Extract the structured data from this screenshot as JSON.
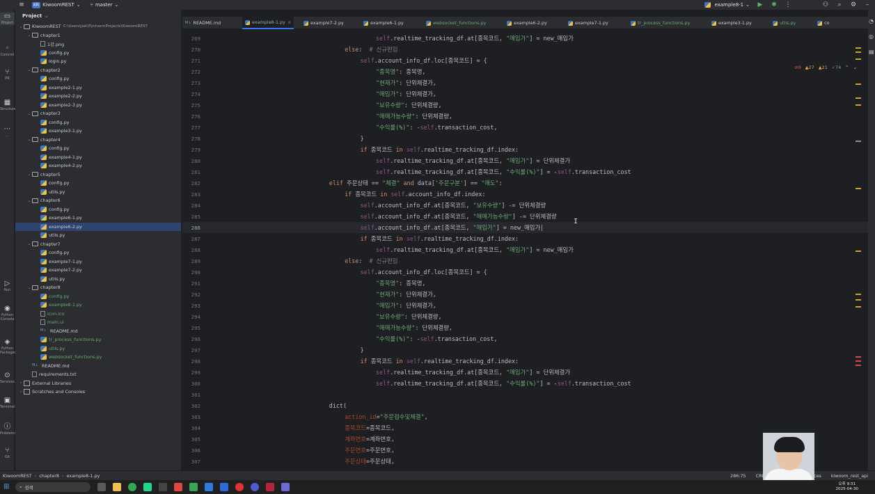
{
  "titlebar": {
    "project_badge": "KR",
    "project_name": "KiwoomREST",
    "branch": "master",
    "run_config": "example8-1"
  },
  "toolstrip": [
    {
      "label": "Project",
      "glyph": "▭"
    },
    {
      "label": "Commit",
      "glyph": "◦"
    },
    {
      "label": "PR",
      "glyph": "⑂"
    },
    {
      "label": "Structure",
      "glyph": "▦"
    },
    {
      "label": "...",
      "glyph": "⋯"
    },
    {
      "label": "Run",
      "glyph": "▷"
    },
    {
      "label": "Python Console",
      "glyph": "◉"
    },
    {
      "label": "Python Packages",
      "glyph": "◈"
    },
    {
      "label": "Services",
      "glyph": "⊙"
    },
    {
      "label": "Terminal",
      "glyph": "▣"
    },
    {
      "label": "Problems",
      "glyph": "ⓘ"
    },
    {
      "label": "Git",
      "glyph": "⑂"
    }
  ],
  "project": {
    "header": "Project",
    "tree": [
      {
        "indent": 0,
        "arrow": "v",
        "type": "folder",
        "label": "KiwoomREST",
        "note": "C:\\Users\\jwk\\PycharmProjects\\KiwoomREST"
      },
      {
        "indent": 1,
        "arrow": "v",
        "type": "folder",
        "label": "chapter1"
      },
      {
        "indent": 2,
        "arrow": "",
        "type": "file",
        "label": "1강.png"
      },
      {
        "indent": 2,
        "arrow": "",
        "type": "py",
        "label": "config.py"
      },
      {
        "indent": 2,
        "arrow": "",
        "type": "py",
        "label": "login.py"
      },
      {
        "indent": 1,
        "arrow": "v",
        "type": "folder",
        "label": "chapter2"
      },
      {
        "indent": 2,
        "arrow": "",
        "type": "py",
        "label": "config.py"
      },
      {
        "indent": 2,
        "arrow": "",
        "type": "py",
        "label": "example2-1.py"
      },
      {
        "indent": 2,
        "arrow": "",
        "type": "py",
        "label": "example2-2.py"
      },
      {
        "indent": 2,
        "arrow": "",
        "type": "py",
        "label": "example2-3.py"
      },
      {
        "indent": 1,
        "arrow": "v",
        "type": "folder",
        "label": "chapter3"
      },
      {
        "indent": 2,
        "arrow": "",
        "type": "py",
        "label": "config.py"
      },
      {
        "indent": 2,
        "arrow": "",
        "type": "py",
        "label": "example3-1.py"
      },
      {
        "indent": 1,
        "arrow": "v",
        "type": "folder",
        "label": "chapter4"
      },
      {
        "indent": 2,
        "arrow": "",
        "type": "py",
        "label": "config.py"
      },
      {
        "indent": 2,
        "arrow": "",
        "type": "py",
        "label": "example4-1.py"
      },
      {
        "indent": 2,
        "arrow": "",
        "type": "py",
        "label": "example4-2.py"
      },
      {
        "indent": 1,
        "arrow": "v",
        "type": "folder",
        "label": "chapter5"
      },
      {
        "indent": 2,
        "arrow": "",
        "type": "py",
        "label": "config.py"
      },
      {
        "indent": 2,
        "arrow": "",
        "type": "py",
        "label": "utils.py"
      },
      {
        "indent": 1,
        "arrow": "v",
        "type": "folder",
        "label": "chapter6"
      },
      {
        "indent": 2,
        "arrow": "",
        "type": "py",
        "label": "config.py"
      },
      {
        "indent": 2,
        "arrow": "",
        "type": "py",
        "label": "example6-1.py"
      },
      {
        "indent": 2,
        "arrow": "",
        "type": "py",
        "label": "example6-2.py",
        "selected": true
      },
      {
        "indent": 2,
        "arrow": "",
        "type": "py",
        "label": "utils.py"
      },
      {
        "indent": 1,
        "arrow": "v",
        "type": "folder",
        "label": "chapter7"
      },
      {
        "indent": 2,
        "arrow": "",
        "type": "py",
        "label": "config.py"
      },
      {
        "indent": 2,
        "arrow": "",
        "type": "py",
        "label": "example7-1.py"
      },
      {
        "indent": 2,
        "arrow": "",
        "type": "py",
        "label": "example7-2.py"
      },
      {
        "indent": 2,
        "arrow": "",
        "type": "py",
        "label": "utils.py"
      },
      {
        "indent": 1,
        "arrow": "v",
        "type": "folder",
        "label": "chapter8"
      },
      {
        "indent": 2,
        "arrow": "",
        "type": "py",
        "label": "config.py",
        "green": true
      },
      {
        "indent": 2,
        "arrow": "",
        "type": "py",
        "label": "example8-1.py",
        "green": true
      },
      {
        "indent": 2,
        "arrow": "",
        "type": "file",
        "label": "icon.ico",
        "green": true
      },
      {
        "indent": 2,
        "arrow": "",
        "type": "file",
        "label": "main.ui",
        "green": true
      },
      {
        "indent": 2,
        "arrow": "",
        "type": "md",
        "label": "README.md"
      },
      {
        "indent": 2,
        "arrow": "",
        "type": "py",
        "label": "tr_process_functions.py",
        "green": true
      },
      {
        "indent": 2,
        "arrow": "",
        "type": "py",
        "label": "utils.py",
        "green": true
      },
      {
        "indent": 2,
        "arrow": "",
        "type": "py",
        "label": "websocket_functions.py",
        "green": true
      },
      {
        "indent": 1,
        "arrow": "",
        "type": "md",
        "label": "README.md"
      },
      {
        "indent": 1,
        "arrow": "",
        "type": "file",
        "label": "requirements.txt"
      },
      {
        "indent": 0,
        "arrow": ">",
        "type": "lib",
        "label": "External Libraries"
      },
      {
        "indent": 0,
        "arrow": ">",
        "type": "lib",
        "label": "Scratches and Consoles"
      }
    ]
  },
  "tabs": [
    {
      "label": "README.md",
      "type": "md"
    },
    {
      "label": "example8-1.py",
      "type": "py",
      "active": true
    },
    {
      "label": "example7-2.py",
      "type": "py"
    },
    {
      "label": "example6-1.py",
      "type": "py"
    },
    {
      "label": "websocket_functions.py",
      "type": "py",
      "green": true
    },
    {
      "label": "example6-2.py",
      "type": "py"
    },
    {
      "label": "example7-1.py",
      "type": "py"
    },
    {
      "label": "tr_process_functions.py",
      "type": "py",
      "green": true
    },
    {
      "label": "example3-1.py",
      "type": "py"
    },
    {
      "label": "utils.py",
      "type": "py",
      "green": true
    },
    {
      "label": "co",
      "type": "py"
    }
  ],
  "inspections": {
    "errors": "9",
    "warnings": "27",
    "weak": "21",
    "ok": "74"
  },
  "editor": {
    "current_line": 286,
    "lines": [
      {
        "n": 269,
        "indent": 20,
        "tokens": [
          [
            "self",
            "self"
          ],
          [
            ".realtime_tracking_df.at[종목코드, ",
            ""
          ],
          [
            "\"매입가\"",
            "str"
          ],
          [
            "] = new_매입가",
            ""
          ]
        ]
      },
      {
        "n": 270,
        "indent": 12,
        "tokens": [
          [
            "else",
            "kw"
          ],
          [
            ":  ",
            ""
          ],
          [
            "# 신규편입",
            "cm"
          ]
        ]
      },
      {
        "n": 271,
        "indent": 16,
        "tokens": [
          [
            "self",
            "self"
          ],
          [
            ".account_info_df.loc[종목코드] = {",
            ""
          ]
        ]
      },
      {
        "n": 272,
        "indent": 20,
        "tokens": [
          [
            "\"종목명\"",
            "str"
          ],
          [
            ": 종목명,",
            ""
          ]
        ]
      },
      {
        "n": 273,
        "indent": 20,
        "tokens": [
          [
            "\"현재가\"",
            "str"
          ],
          [
            ": 단위체결가,",
            ""
          ]
        ]
      },
      {
        "n": 274,
        "indent": 20,
        "tokens": [
          [
            "\"매입가\"",
            "str"
          ],
          [
            ": 단위체결가,",
            ""
          ]
        ]
      },
      {
        "n": 275,
        "indent": 20,
        "tokens": [
          [
            "\"보유수량\"",
            "str"
          ],
          [
            ": 단위체결량,",
            ""
          ]
        ]
      },
      {
        "n": 276,
        "indent": 20,
        "tokens": [
          [
            "\"매매가능수량\"",
            "str"
          ],
          [
            ": 단위체결량,",
            ""
          ]
        ]
      },
      {
        "n": 277,
        "indent": 20,
        "tokens": [
          [
            "\"수익률(%)\"",
            "str"
          ],
          [
            ": -",
            ""
          ],
          [
            "self",
            "self"
          ],
          [
            ".transaction_cost,",
            ""
          ]
        ]
      },
      {
        "n": 278,
        "indent": 16,
        "tokens": [
          [
            "}",
            ""
          ]
        ]
      },
      {
        "n": 279,
        "indent": 16,
        "tokens": [
          [
            "if",
            "kw"
          ],
          [
            " 종목코드 ",
            ""
          ],
          [
            "in",
            "kw"
          ],
          [
            " ",
            ""
          ],
          [
            "self",
            "self"
          ],
          [
            ".realtime_tracking_df.index:",
            ""
          ]
        ]
      },
      {
        "n": 280,
        "indent": 20,
        "tokens": [
          [
            "self",
            "self"
          ],
          [
            ".realtime_tracking_df.at[종목코드, ",
            ""
          ],
          [
            "\"매입가\"",
            "str"
          ],
          [
            "] = 단위체결가",
            ""
          ]
        ]
      },
      {
        "n": 281,
        "indent": 20,
        "tokens": [
          [
            "self",
            "self"
          ],
          [
            ".realtime_tracking_df.at[종목코드, ",
            ""
          ],
          [
            "\"수익률(%)\"",
            "str"
          ],
          [
            "] = -",
            ""
          ],
          [
            "self",
            "self"
          ],
          [
            ".transaction_cost",
            ""
          ]
        ]
      },
      {
        "n": 282,
        "indent": 8,
        "tokens": [
          [
            "elif",
            "kw"
          ],
          [
            " 주문상태 == ",
            ""
          ],
          [
            "\"체결\"",
            "str"
          ],
          [
            " ",
            ""
          ],
          [
            "and",
            "kw"
          ],
          [
            " data[",
            ""
          ],
          [
            "'주문구분'",
            "str"
          ],
          [
            "] == ",
            ""
          ],
          [
            "\"매도\"",
            "str"
          ],
          [
            ":",
            ""
          ]
        ]
      },
      {
        "n": 283,
        "indent": 12,
        "tokens": [
          [
            "if",
            "kw"
          ],
          [
            " 종목코드 ",
            ""
          ],
          [
            "in",
            "kw"
          ],
          [
            " ",
            ""
          ],
          [
            "self",
            "self"
          ],
          [
            ".account_info_df.index:",
            ""
          ]
        ]
      },
      {
        "n": 284,
        "indent": 16,
        "tokens": [
          [
            "self",
            "self"
          ],
          [
            ".account_info_df.at[종목코드, ",
            ""
          ],
          [
            "\"보유수량\"",
            "str"
          ],
          [
            "] -= 단위체결량",
            ""
          ]
        ]
      },
      {
        "n": 285,
        "indent": 16,
        "tokens": [
          [
            "self",
            "self"
          ],
          [
            ".account_info_df.at[종목코드, ",
            ""
          ],
          [
            "\"매매가능수량\"",
            "str"
          ],
          [
            "] -= 단위체결량",
            ""
          ]
        ]
      },
      {
        "n": 286,
        "indent": 16,
        "tokens": [
          [
            "self",
            "self"
          ],
          [
            ".account_info_df.at[종목코드, ",
            ""
          ],
          [
            "\"매입가\"",
            "str"
          ],
          [
            "] = new_매입가|",
            ""
          ]
        ]
      },
      {
        "n": 287,
        "indent": 16,
        "tokens": [
          [
            "if",
            "kw"
          ],
          [
            " 종목코드 ",
            ""
          ],
          [
            "in",
            "kw"
          ],
          [
            " ",
            ""
          ],
          [
            "self",
            "self"
          ],
          [
            ".realtime_tracking_df.index:",
            ""
          ]
        ]
      },
      {
        "n": 288,
        "indent": 20,
        "tokens": [
          [
            "self",
            "self"
          ],
          [
            ".realtime_tracking_df.at[종목코드, ",
            ""
          ],
          [
            "\"매입가\"",
            "str"
          ],
          [
            "] = new_매입가",
            ""
          ]
        ]
      },
      {
        "n": 289,
        "indent": 12,
        "tokens": [
          [
            "else",
            "kw"
          ],
          [
            ":  ",
            ""
          ],
          [
            "# 신규편입",
            "cm"
          ]
        ]
      },
      {
        "n": 290,
        "indent": 16,
        "tokens": [
          [
            "self",
            "self"
          ],
          [
            ".account_info_df.loc[종목코드] = {",
            ""
          ]
        ]
      },
      {
        "n": 291,
        "indent": 20,
        "tokens": [
          [
            "\"종목명\"",
            "str"
          ],
          [
            ": 종목명,",
            ""
          ]
        ]
      },
      {
        "n": 292,
        "indent": 20,
        "tokens": [
          [
            "\"현재가\"",
            "str"
          ],
          [
            ": 단위체결가,",
            ""
          ]
        ]
      },
      {
        "n": 293,
        "indent": 20,
        "tokens": [
          [
            "\"매입가\"",
            "str"
          ],
          [
            ": 단위체결가,",
            ""
          ]
        ]
      },
      {
        "n": 294,
        "indent": 20,
        "tokens": [
          [
            "\"보유수량\"",
            "str"
          ],
          [
            ": 단위체결량,",
            ""
          ]
        ]
      },
      {
        "n": 295,
        "indent": 20,
        "tokens": [
          [
            "\"매매가능수량\"",
            "str"
          ],
          [
            ": 단위체결량,",
            ""
          ]
        ]
      },
      {
        "n": 296,
        "indent": 20,
        "tokens": [
          [
            "\"수익률(%)\"",
            "str"
          ],
          [
            ": -",
            ""
          ],
          [
            "self",
            "self"
          ],
          [
            ".transaction_cost,",
            ""
          ]
        ]
      },
      {
        "n": 297,
        "indent": 16,
        "tokens": [
          [
            "}",
            ""
          ]
        ]
      },
      {
        "n": 298,
        "indent": 16,
        "tokens": [
          [
            "if",
            "kw"
          ],
          [
            " 종목코드 ",
            ""
          ],
          [
            "in",
            "kw"
          ],
          [
            " ",
            ""
          ],
          [
            "self",
            "self"
          ],
          [
            ".realtime_tracking_df.index:",
            ""
          ]
        ]
      },
      {
        "n": 299,
        "indent": 20,
        "tokens": [
          [
            "self",
            "self"
          ],
          [
            ".realtime_tracking_df.at[종목코드, ",
            ""
          ],
          [
            "\"매입가\"",
            "str"
          ],
          [
            "] = 단위체결가",
            ""
          ]
        ]
      },
      {
        "n": 300,
        "indent": 20,
        "tokens": [
          [
            "self",
            "self"
          ],
          [
            ".realtime_tracking_df.at[종목코드, ",
            ""
          ],
          [
            "\"수익률(%)\"",
            "str"
          ],
          [
            "] = -",
            ""
          ],
          [
            "self",
            "self"
          ],
          [
            ".transaction_cost",
            ""
          ]
        ]
      },
      {
        "n": 301,
        "indent": 0,
        "tokens": []
      },
      {
        "n": 302,
        "indent": 8,
        "tokens": [
          [
            "dict(",
            ""
          ]
        ]
      },
      {
        "n": 303,
        "indent": 12,
        "tokens": [
          [
            "action_id",
            "kwarg"
          ],
          [
            "=",
            ""
          ],
          [
            "\"주문접수및체결\"",
            "str"
          ],
          [
            ",",
            ""
          ]
        ]
      },
      {
        "n": 304,
        "indent": 12,
        "tokens": [
          [
            "종목코드",
            "kwarg"
          ],
          [
            "=종목코드,",
            ""
          ]
        ]
      },
      {
        "n": 305,
        "indent": 12,
        "tokens": [
          [
            "계좌번호",
            "kwarg"
          ],
          [
            "=계좌번호,",
            ""
          ]
        ]
      },
      {
        "n": 306,
        "indent": 12,
        "tokens": [
          [
            "주문번호",
            "kwarg"
          ],
          [
            "=주문번호,",
            ""
          ]
        ]
      },
      {
        "n": 307,
        "indent": 12,
        "tokens": [
          [
            "주문상태",
            "kwarg"
          ],
          [
            "=주문상태,",
            ""
          ]
        ]
      }
    ]
  },
  "statusbar": {
    "breadcrumb": [
      "KiwoomREST",
      "chapter8",
      "example8-1.py"
    ],
    "position": "286:75",
    "line_sep": "CRLF",
    "indent": "spaces",
    "interpreter": "kiwoom_rest_api"
  },
  "taskbar": {
    "search_placeholder": "검색",
    "time": "오후 9:31",
    "date": "2025-04-30"
  }
}
